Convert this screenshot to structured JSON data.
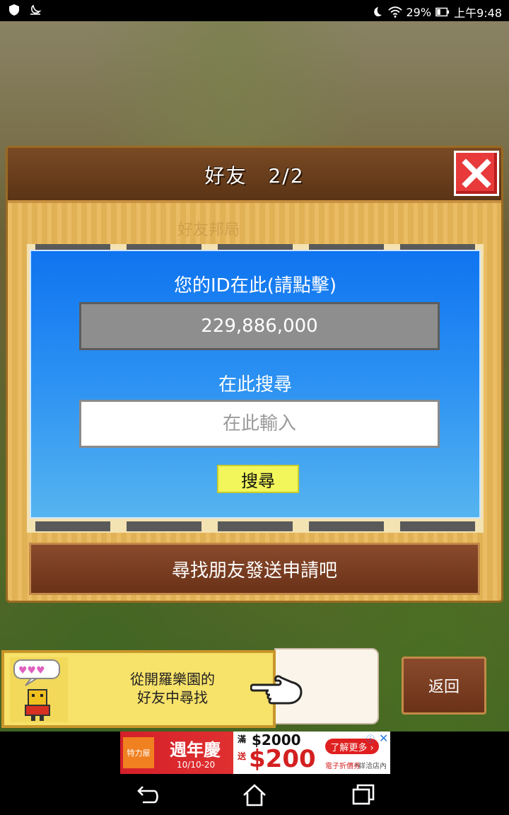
{
  "status_bar": {
    "battery": "29%",
    "time": "上午9:48",
    "left_icons": [
      "shield-icon",
      "moon-hat-icon"
    ],
    "right_icons": [
      "moon-icon",
      "wifi-icon",
      "battery-icon"
    ]
  },
  "dialog": {
    "title": "好友　2/2",
    "faded_label": "好友邦局",
    "id_label": "您的ID在此(請點擊)",
    "id_value": "229,886,000",
    "search_label": "在此搜尋",
    "search_placeholder": "在此輸入",
    "search_button": "搜尋",
    "send_request": "尋找朋友發送申請吧"
  },
  "hint": {
    "line1": "從開羅樂園的",
    "line2": "好友中尋找"
  },
  "return_button": "返回",
  "ad": {
    "logo_text": "特力屋",
    "title": "週年慶",
    "date": "10/10-20",
    "man": "滿",
    "amount1": "$2000",
    "song": "送",
    "amount2": "$200",
    "more": "了解更多 ›",
    "sub": "電子折價券",
    "note": "*詳洽店內",
    "info": "ⓘ",
    "close": "✕"
  },
  "colors": {
    "panel_blue": "#1e80f0",
    "dialog_wood": "#e8b758",
    "header_brown": "#6a3e1c",
    "search_button_yellow": "#f2f65a",
    "close_red": "#e83a3a"
  }
}
